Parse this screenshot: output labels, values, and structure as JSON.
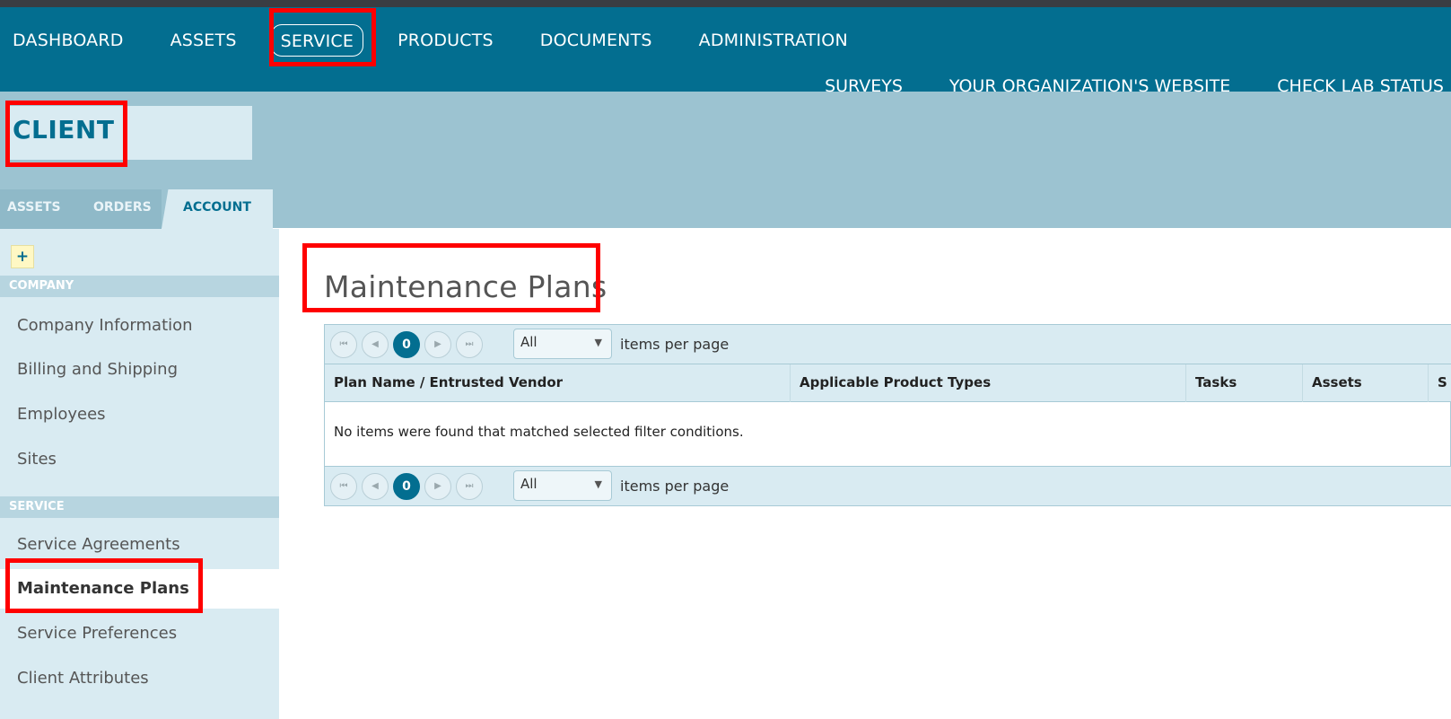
{
  "top_nav": {
    "items": [
      {
        "label": "DASHBOARD"
      },
      {
        "label": "ASSETS"
      },
      {
        "label": "SERVICE"
      },
      {
        "label": "PRODUCTS"
      },
      {
        "label": "DOCUMENTS"
      },
      {
        "label": "ADMINISTRATION"
      }
    ],
    "active": "SERVICE"
  },
  "sub_nav": {
    "items": [
      {
        "label": "SURVEYS"
      },
      {
        "label": "YOUR ORGANIZATION'S WEBSITE"
      },
      {
        "label": "CHECK LAB STATUS"
      }
    ]
  },
  "client": {
    "title": "CLIENT"
  },
  "tabs": [
    {
      "label": "ASSETS"
    },
    {
      "label": "ORDERS"
    },
    {
      "label": "ACCOUNT"
    }
  ],
  "sidebar": {
    "add_label": "+",
    "sections": [
      {
        "header": "COMPANY",
        "items": [
          {
            "label": "Company Information"
          },
          {
            "label": "Billing and Shipping"
          },
          {
            "label": "Employees"
          },
          {
            "label": "Sites"
          }
        ]
      },
      {
        "header": "SERVICE",
        "items": [
          {
            "label": "Service Agreements"
          },
          {
            "label": "Maintenance Plans"
          },
          {
            "label": "Service Preferences"
          },
          {
            "label": "Client Attributes"
          }
        ]
      }
    ],
    "active_item": "Maintenance Plans"
  },
  "main": {
    "title": "Maintenance Plans",
    "pager": {
      "first": "⏮",
      "prev": "◀",
      "page": "0",
      "next": "▶",
      "last": "⏭",
      "page_size": "All",
      "page_size_label": "items per page"
    },
    "columns": [
      {
        "label": "Plan Name / Entrusted Vendor"
      },
      {
        "label": "Applicable Product Types"
      },
      {
        "label": "Tasks"
      },
      {
        "label": "Assets"
      },
      {
        "label": "S"
      }
    ],
    "empty_message": "No items were found that matched selected filter conditions."
  },
  "colors": {
    "brand_blue": "#036e90",
    "band": "#9cc3d1",
    "light_panel": "#d9ebf2",
    "highlight": "#ff0000"
  }
}
